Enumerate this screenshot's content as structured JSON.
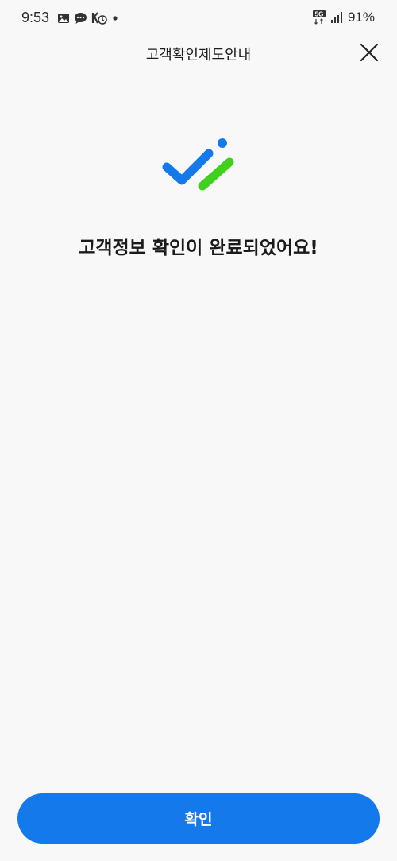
{
  "status_bar": {
    "time": "9:53",
    "battery": "91%",
    "network": "5G",
    "left_icons": [
      "image-icon",
      "chat-icon",
      "vpn-icon",
      "dot-icon"
    ],
    "right_icons": [
      "5g-icon",
      "signal-icon"
    ]
  },
  "header": {
    "title": "고객확인제도안내",
    "close_icon": "close-icon"
  },
  "logo": {
    "icon": "double-check-icon",
    "colors": {
      "blue": "#1479ea",
      "green": "#3fd11c"
    }
  },
  "main": {
    "headline": "고객정보 확인이 완료되었어요!"
  },
  "footer": {
    "confirm_label": "확인",
    "confirm_color": "#1479ea"
  }
}
